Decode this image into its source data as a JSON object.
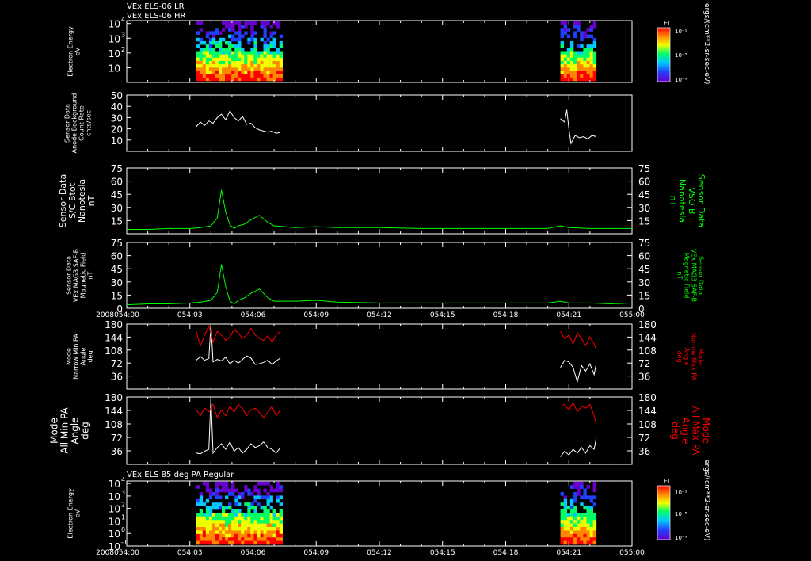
{
  "header": {
    "line1": "VEx ELS-06 LR",
    "line2": "VEx ELS-06 HR"
  },
  "colorbar": {
    "label": "EI",
    "ticks": [
      "10⁻¹",
      "10⁻⁵",
      "10⁻⁹"
    ],
    "units": "ergs/(cm**2-sr-sec-eV)"
  },
  "bottom_panel_title": "VEx ELS 85 deg PA Regular",
  "year_label": "2008",
  "time_ticks": [
    "054:00",
    "054:03",
    "054:06",
    "054:09",
    "054:12",
    "054:15",
    "054:18",
    "054:21",
    "055:00"
  ],
  "colors": {
    "white_trace": "#ffffff",
    "green_trace": "#00ff00",
    "red_trace": "#ff0000",
    "axis": "#ffffff"
  },
  "chart_data": [
    {
      "type": "heatmap",
      "name": "spectrogram-top",
      "ylabel": [
        "Electron Energy",
        "eV"
      ],
      "yticks": [
        {
          "base": "10",
          "exp": "4"
        },
        {
          "base": "10",
          "exp": "3"
        },
        {
          "base": "10",
          "exp": "2"
        },
        {
          "base": "10",
          "exp": ""
        }
      ],
      "ylim_log10": [
        0,
        4.2
      ],
      "data_intervals": [
        [
          3.3,
          7.4
        ],
        [
          20.6,
          22.3
        ]
      ]
    },
    {
      "type": "line",
      "name": "anode-background",
      "ylabel": [
        "Sensor Data",
        "Anode Background",
        "Count Rate",
        "cnts/sec"
      ],
      "ylim": [
        0,
        50
      ],
      "yticks": [
        10,
        20,
        30,
        40,
        50
      ],
      "series": [
        {
          "color": "white",
          "x": [
            3.3,
            3.5,
            3.7,
            3.9,
            4.1,
            4.3,
            4.5,
            4.7,
            4.9,
            5.1,
            5.3,
            5.5,
            5.7,
            5.9,
            6.1,
            6.3,
            6.5,
            6.7,
            6.9,
            7.1,
            7.3
          ],
          "y": [
            22,
            26,
            23,
            27,
            25,
            30,
            33,
            28,
            36,
            30,
            27,
            31,
            24,
            25,
            21,
            19,
            18,
            17,
            18,
            16,
            17
          ]
        },
        {
          "color": "white",
          "x": [
            20.6,
            20.8,
            20.9,
            21.0,
            21.1,
            21.3,
            21.5,
            21.7,
            21.9,
            22.1,
            22.3
          ],
          "y": [
            29,
            26,
            37,
            20,
            7,
            14,
            12,
            13,
            11,
            14,
            13
          ]
        }
      ]
    },
    {
      "type": "line",
      "name": "sc-btot",
      "ylabel": [
        "Sensor Data",
        "S/C Btot",
        "Nanotesla",
        "nT"
      ],
      "ylabel_right": [
        "Sensor Data",
        "VSO B",
        "Nanotesla",
        "nT"
      ],
      "ylim": [
        0,
        75
      ],
      "yticks": [
        15,
        30,
        45,
        60,
        75
      ],
      "series": [
        {
          "color": "green",
          "x": [
            0,
            1,
            2,
            3,
            3.5,
            4,
            4.3,
            4.5,
            4.7,
            4.9,
            5.1,
            5.3,
            5.6,
            5.9,
            6.3,
            6.7,
            7,
            8,
            9,
            10,
            12,
            14,
            16,
            18,
            20,
            20.6,
            21,
            22,
            23,
            24
          ],
          "y": [
            5,
            5,
            6,
            6,
            7,
            9,
            18,
            50,
            25,
            10,
            6,
            9,
            11,
            16,
            21,
            13,
            9,
            7,
            8,
            7,
            7,
            6,
            6,
            6,
            6,
            9,
            7,
            6,
            6,
            6
          ]
        }
      ]
    },
    {
      "type": "line",
      "name": "mag3-saf",
      "ylabel": [
        "Sensor Data",
        "VEx MAG3 SAF-B",
        "Magnetic Field",
        "nT"
      ],
      "ylabel_right": [
        "Sensor Data",
        "VEx MAG3 SAF-B",
        "Magnetic Field",
        "nT"
      ],
      "ylim": [
        0,
        75
      ],
      "yticks": [
        0,
        15,
        30,
        45,
        60,
        75
      ],
      "series": [
        {
          "color": "green",
          "x": [
            0,
            1,
            2,
            3,
            3.5,
            4,
            4.3,
            4.5,
            4.7,
            4.9,
            5.1,
            5.3,
            5.6,
            5.9,
            6.3,
            6.7,
            7,
            8,
            9,
            10,
            12,
            14,
            16,
            18,
            20,
            20.6,
            21,
            22,
            23,
            24
          ],
          "y": [
            4,
            5,
            5,
            6,
            7,
            9,
            18,
            50,
            25,
            8,
            5,
            9,
            12,
            17,
            22,
            12,
            8,
            8,
            9,
            7,
            6,
            6,
            6,
            6,
            6,
            8,
            6,
            6,
            5,
            6
          ]
        }
      ]
    },
    {
      "type": "line",
      "name": "narrow-pa",
      "ylabel": [
        "Mode",
        "Narrow Min PA",
        "Angle",
        "deg"
      ],
      "ylabel_right": [
        "Mode",
        "Narrow Max PA",
        "Angle",
        "deg"
      ],
      "ylim": [
        0,
        180
      ],
      "yticks": [
        36,
        72,
        108,
        144,
        180
      ],
      "series": [
        {
          "color": "white",
          "x": [
            3.3,
            3.5,
            3.7,
            3.9,
            4.0,
            4.1,
            4.3,
            4.5,
            4.7,
            4.9,
            5.1,
            5.3,
            5.5,
            5.7,
            5.9,
            6.1,
            6.3,
            6.5,
            6.7,
            6.9,
            7.1,
            7.3
          ],
          "y": [
            80,
            90,
            80,
            85,
            180,
            75,
            82,
            78,
            88,
            70,
            80,
            72,
            82,
            92,
            86,
            68,
            70,
            74,
            80,
            68,
            78,
            86
          ]
        },
        {
          "color": "red",
          "x": [
            3.3,
            3.5,
            3.7,
            3.9,
            4.1,
            4.3,
            4.5,
            4.7,
            4.9,
            5.1,
            5.3,
            5.5,
            5.7,
            5.9,
            6.1,
            6.3,
            6.5,
            6.7,
            6.9,
            7.1,
            7.3
          ],
          "y": [
            160,
            120,
            150,
            175,
            130,
            160,
            150,
            135,
            145,
            165,
            155,
            140,
            150,
            168,
            150,
            140,
            135,
            148,
            130,
            150,
            160
          ]
        },
        {
          "color": "white",
          "x": [
            20.6,
            20.8,
            21.0,
            21.2,
            21.4,
            21.6,
            21.8,
            22.0,
            22.2,
            22.3
          ],
          "y": [
            60,
            80,
            75,
            60,
            20,
            65,
            50,
            70,
            40,
            70
          ]
        },
        {
          "color": "red",
          "x": [
            20.6,
            20.8,
            21.0,
            21.2,
            21.4,
            21.6,
            21.8,
            22.0,
            22.2,
            22.3
          ],
          "y": [
            160,
            140,
            150,
            125,
            155,
            140,
            120,
            145,
            125,
            110
          ]
        }
      ]
    },
    {
      "type": "line",
      "name": "all-pa",
      "ylabel": [
        "Mode",
        "All Min PA",
        "Angle",
        "deg"
      ],
      "ylabel_right": [
        "Mode",
        "All Max PA",
        "Angle",
        "deg"
      ],
      "ylim": [
        0,
        180
      ],
      "yticks": [
        36,
        72,
        108,
        144,
        180
      ],
      "series": [
        {
          "color": "white",
          "x": [
            3.3,
            3.5,
            3.7,
            3.9,
            4.0,
            4.1,
            4.3,
            4.5,
            4.7,
            4.9,
            5.1,
            5.3,
            5.5,
            5.7,
            5.9,
            6.1,
            6.3,
            6.5,
            6.7,
            6.9,
            7.1,
            7.3
          ],
          "y": [
            30,
            28,
            35,
            40,
            180,
            30,
            45,
            55,
            40,
            60,
            35,
            45,
            30,
            40,
            55,
            45,
            50,
            60,
            45,
            40,
            30,
            45
          ]
        },
        {
          "color": "red",
          "x": [
            3.3,
            3.5,
            3.7,
            3.9,
            4.1,
            4.3,
            4.5,
            4.7,
            4.9,
            5.1,
            5.3,
            5.5,
            5.7,
            5.9,
            6.1,
            6.3,
            6.5,
            6.7,
            6.9,
            7.1,
            7.3
          ],
          "y": [
            145,
            130,
            150,
            140,
            160,
            125,
            145,
            130,
            155,
            140,
            160,
            148,
            130,
            145,
            150,
            138,
            125,
            140,
            155,
            130,
            145
          ]
        },
        {
          "color": "white",
          "x": [
            20.6,
            20.8,
            21.0,
            21.2,
            21.4,
            21.6,
            21.8,
            22.0,
            22.2,
            22.3
          ],
          "y": [
            20,
            35,
            25,
            40,
            30,
            45,
            30,
            50,
            40,
            70
          ]
        },
        {
          "color": "red",
          "x": [
            20.6,
            20.8,
            21.0,
            21.2,
            21.4,
            21.6,
            21.8,
            22.0,
            22.2,
            22.3
          ],
          "y": [
            155,
            160,
            145,
            165,
            140,
            155,
            150,
            160,
            130,
            110
          ]
        }
      ]
    },
    {
      "type": "heatmap",
      "name": "spectrogram-bottom",
      "ylabel": [
        "Electron Energy",
        "eV"
      ],
      "yticks": [
        {
          "base": "10",
          "exp": "4"
        },
        {
          "base": "10",
          "exp": "3"
        },
        {
          "base": "10",
          "exp": "2"
        },
        {
          "base": "10",
          "exp": "1"
        },
        {
          "base": "10",
          "exp": "0"
        },
        {
          "base": "10",
          "exp": "-1"
        }
      ],
      "ylim_log10": [
        -1,
        4.2
      ],
      "data_intervals": [
        [
          3.3,
          7.4
        ],
        [
          20.6,
          22.3
        ]
      ]
    }
  ]
}
